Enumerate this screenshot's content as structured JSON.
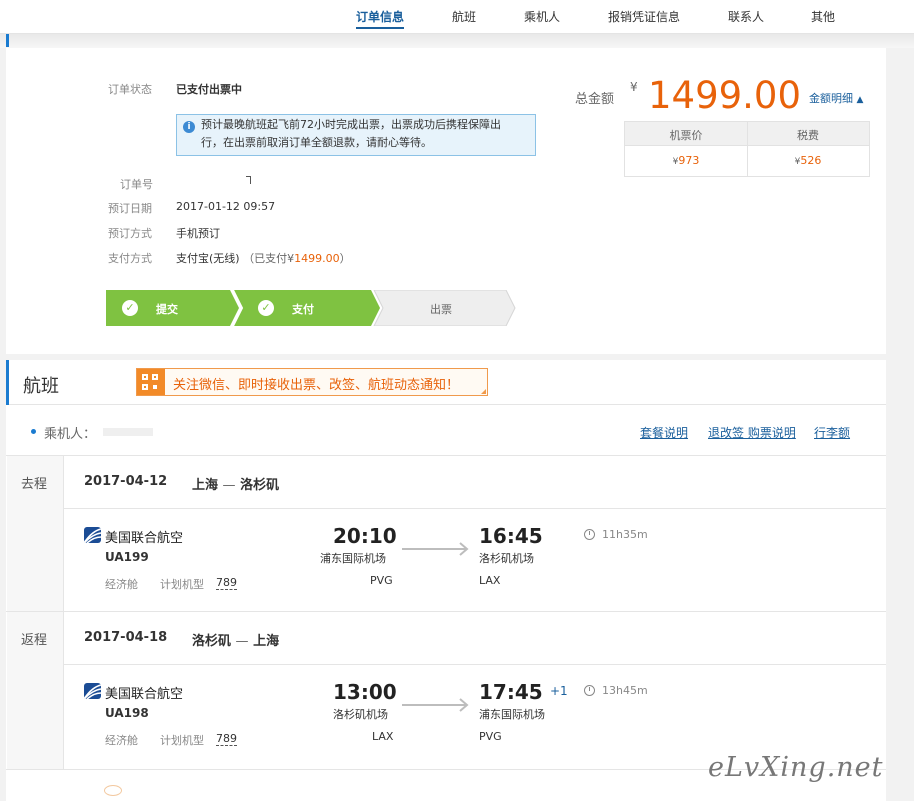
{
  "nav": {
    "tabs": [
      "订单信息",
      "航班",
      "乘机人",
      "报销凭证信息",
      "联系人",
      "其他"
    ]
  },
  "order": {
    "status_label": "订单状态",
    "status_value": "已支付出票中",
    "notice_line1": "预计最晚航班起飞前72小时完成出票，出票成功后携程保障出",
    "notice_line2": "行，在出票前取消订单全额退款，请耐心等待。",
    "order_no_label": "订单号",
    "booking_date_label": "预订日期",
    "booking_date_value": "2017-01-12 09:57",
    "booking_method_label": "预订方式",
    "booking_method_value": "手机预订",
    "payment_label": "支付方式",
    "payment_value": "支付宝(无线)",
    "paid_prefix": "（已支付¥",
    "paid_amount": "1499.00",
    "paid_suffix": "）"
  },
  "steps": [
    "提交",
    "支付",
    "出票"
  ],
  "price": {
    "total_label": "总金额",
    "currency": "¥",
    "total": "1499.00",
    "detail_link": "金额明细",
    "ticket_label": "机票价",
    "tax_label": "税费",
    "ticket_value": "973",
    "tax_value": "526",
    "yen": "¥"
  },
  "flight": {
    "title": "航班",
    "wechat_text": "关注微信、即时接收出票、改签、航班动态通知！",
    "passenger_label": "乘机人：",
    "links": [
      "套餐说明",
      "退改签 购票说明",
      "行李额"
    ],
    "trips": [
      {
        "direction": "去程",
        "date": "2017-04-12",
        "from_city": "上海",
        "dash": "—",
        "to_city": "洛杉矶",
        "airline": "美国联合航空",
        "flight_no": "UA199",
        "cabin": "经济舱",
        "plane_label": "计划机型",
        "plane": "789",
        "dep_time": "20:10",
        "dep_airport": "浦东国际机场",
        "dep_code": "PVG",
        "arr_time": "16:45",
        "arr_airport": "洛杉矶机场",
        "arr_code": "LAX",
        "plus_day": "",
        "duration": "11h35m"
      },
      {
        "direction": "返程",
        "date": "2017-04-18",
        "from_city": "洛杉矶",
        "dash": "—",
        "to_city": "上海",
        "airline": "美国联合航空",
        "flight_no": "UA198",
        "cabin": "经济舱",
        "plane_label": "计划机型",
        "plane": "789",
        "dep_time": "13:00",
        "dep_airport": "洛杉矶机场",
        "dep_code": "LAX",
        "arr_time": "17:45",
        "arr_airport": "浦东国际机场",
        "arr_code": "PVG",
        "plus_day": "+1",
        "duration": "13h45m"
      }
    ]
  },
  "watermark": "eLvXing.net",
  "colors": {
    "accent": "#1a5f9c",
    "price": "#e8620a",
    "step_done": "#7fc241"
  }
}
